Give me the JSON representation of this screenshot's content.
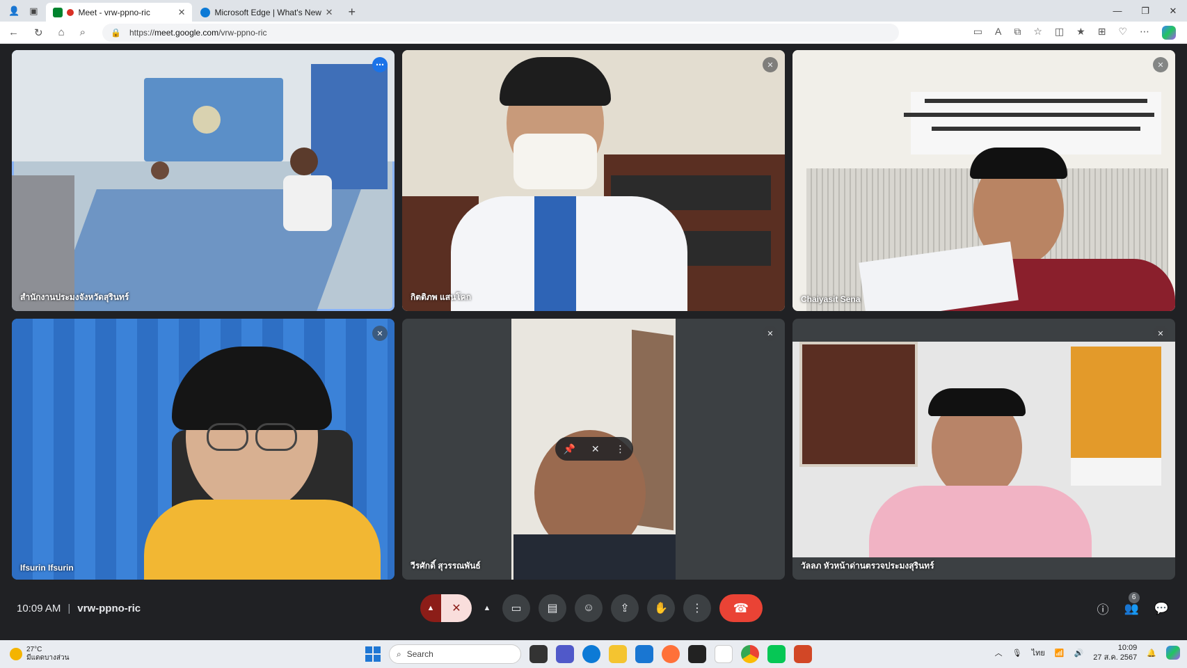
{
  "browser": {
    "tabs": [
      {
        "title": "Meet - vrw-ppno-ric",
        "active": true
      },
      {
        "title": "Microsoft Edge | What's New",
        "active": false
      }
    ],
    "url_prefix": "https://",
    "url_host": "meet.google.com",
    "url_path": "/vrw-ppno-ric"
  },
  "participants": [
    {
      "name": "สำนักงานประมงจังหวัดสุรินทร์",
      "muted": false,
      "active": true
    },
    {
      "name": "กิตติภพ แสนโคก",
      "muted": true
    },
    {
      "name": "Chaiyasit Sena",
      "muted": true
    },
    {
      "name": "Ifsurin Ifsurin",
      "muted": true
    },
    {
      "name": "วีรศักดิ์ สุวรรณพันธ์",
      "muted": true
    },
    {
      "name": "วัลลภ หัวหน้าด่านตรวจประมงสุรินทร์",
      "muted": true
    }
  ],
  "meeting": {
    "time": "10:09 AM",
    "separator": "|",
    "code": "vrw-ppno-ric",
    "people_count": "6"
  },
  "taskbar": {
    "temp": "27°C",
    "weather_desc": "มีแดดบางส่วน",
    "search_placeholder": "Search",
    "lang": "ไทย",
    "time": "10:09",
    "date": "27 ส.ค. 2567"
  },
  "colors": {
    "active_outline": "#8ab4f8",
    "hangup": "#ea4335",
    "mic_muted_bg": "#f9dedc",
    "tile_bg": "#3c4043"
  }
}
